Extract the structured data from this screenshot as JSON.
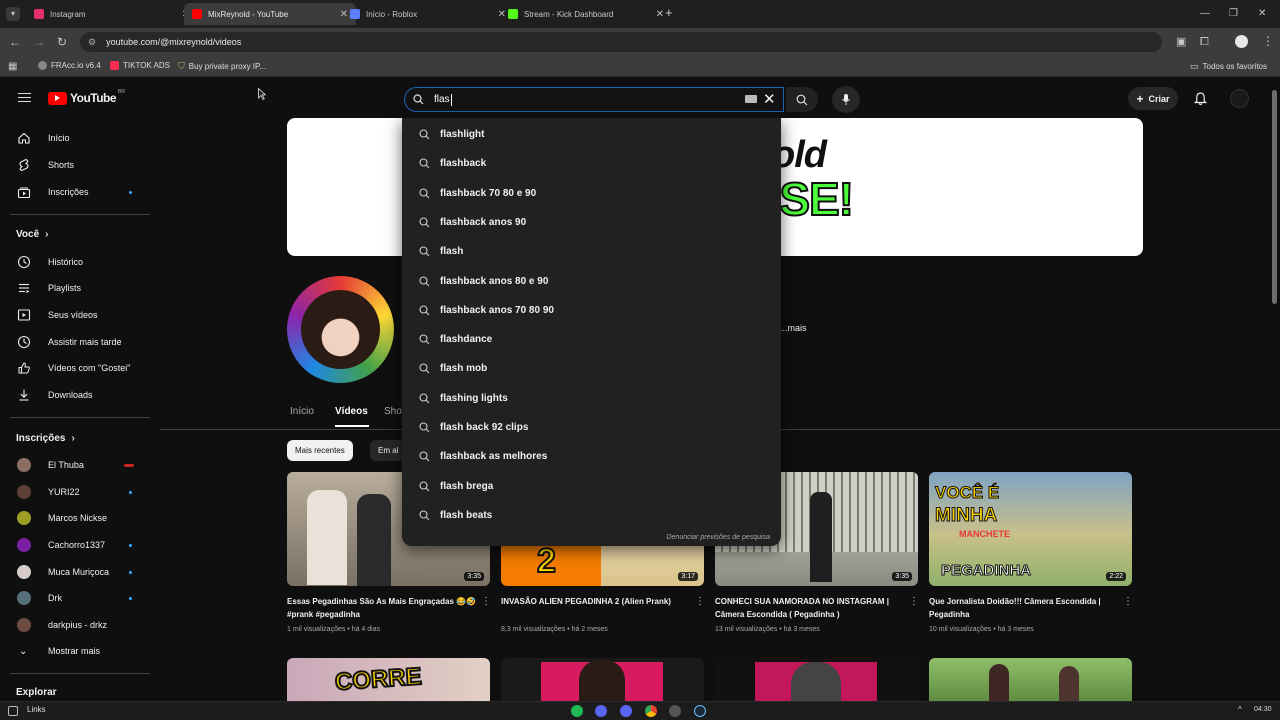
{
  "browser": {
    "tabs": [
      {
        "title": "Instagram",
        "color": "#e1306c"
      },
      {
        "title": "MixReynold - YouTube",
        "color": "#ff0000"
      },
      {
        "title": "Início - Roblox",
        "color": "#5b7fff"
      },
      {
        "title": "Stream - Kick Dashboard",
        "color": "#53fc18"
      }
    ],
    "new_tab": "+",
    "url": "youtube.com/@mixreynold/videos",
    "bookmarks": [
      "FRAcc.io v6.4",
      "TIKTOK ADS",
      "Buy private proxy IP..."
    ],
    "favorites": "Todos os favoritos"
  },
  "youtube": {
    "logo": "YouTube",
    "logo_region": "BR",
    "search_query": "flas",
    "create_label": "Criar"
  },
  "sidebar": {
    "main": [
      {
        "label": "Início",
        "icon": "home-icon"
      },
      {
        "label": "Shorts",
        "icon": "shorts-icon"
      },
      {
        "label": "Inscrições",
        "icon": "subscriptions-icon"
      }
    ],
    "you_heading": "Você",
    "you_items": [
      {
        "label": "Histórico",
        "icon": "history-icon"
      },
      {
        "label": "Playlists",
        "icon": "playlists-icon"
      },
      {
        "label": "Seus vídeos",
        "icon": "your-videos-icon"
      },
      {
        "label": "Assistir mais tarde",
        "icon": "watch-later-icon"
      },
      {
        "label": "Vídeos com \"Gostei\"",
        "icon": "liked-icon"
      },
      {
        "label": "Downloads",
        "icon": "download-icon"
      }
    ],
    "subs_heading": "Inscrições",
    "subs": [
      {
        "label": "El Thuba",
        "color": "#8d6e63"
      },
      {
        "label": "YURI22",
        "color": "#5d4037"
      },
      {
        "label": "Marcos Nickse",
        "color": "#9e9d24"
      },
      {
        "label": "Cachorro1337",
        "color": "#7b1fa2"
      },
      {
        "label": "Muca Muriçoca",
        "color": "#d7ccc8"
      },
      {
        "label": "Drk",
        "color": "#546e7a"
      },
      {
        "label": "darkpius - drkz",
        "color": "#6d4c41"
      }
    ],
    "show_more": "Mostrar mais",
    "explore": "Explorar"
  },
  "channel": {
    "banner_text_1": "old",
    "banner_text_2": "-SE!",
    "more": "...mais",
    "tabs": [
      "Início",
      "Vídeos",
      "Sho"
    ],
    "chips": [
      "Mais recentes",
      "Em al"
    ]
  },
  "videos": [
    {
      "title": "Essas Pegadinhas São As Mais Engraçadas 😂🤣 #prank #pegadinha",
      "views": "1 mil visualizações",
      "age": "há 4 dias",
      "duration": "3:35",
      "thumb": "#8a8275"
    },
    {
      "title": "INVASÃO ALIEN PEGADINHA 2 (Alien Prank)",
      "views": "8,3 mil visualizações",
      "age": "há 2 meses",
      "duration": "3:17",
      "thumb": "#f57c00",
      "thumb_text": "2"
    },
    {
      "title": "CONHECI SUA NAMORADA NO INSTAGRAM | Câmera Escondida ( Pegadinha )",
      "views": "13 mil visualizações",
      "age": "há 3 meses",
      "duration": "3:35",
      "thumb": "#9e9e93"
    },
    {
      "title": "Que Jornalista Doidão!!! Câmera Escondida | Pegadinha",
      "views": "10 mil visualizações",
      "age": "há 3 meses",
      "duration": "2:22",
      "thumb": "#8fb06a",
      "thumb_text_1": "VOCÊ É",
      "thumb_text_2": "MINHA",
      "thumb_text_3": "MANCHETE",
      "thumb_text_4": "PEGADINHA"
    }
  ],
  "row2_thumb_text": "CORRE",
  "suggestions": [
    "flashlight",
    "flashback",
    "flashback 70 80 e 90",
    "flashback anos 90",
    "flash",
    "flashback anos 80 e 90",
    "flashback anos 70 80 90",
    "flashdance",
    "flash mob",
    "flashing lights",
    "flash back 92 clips",
    "flashback as melhores",
    "flash brega",
    "flash beats"
  ],
  "report_label": "Denunciar previsões de pesquisa",
  "taskbar": {
    "left_label": "Links",
    "time": "04:30"
  }
}
